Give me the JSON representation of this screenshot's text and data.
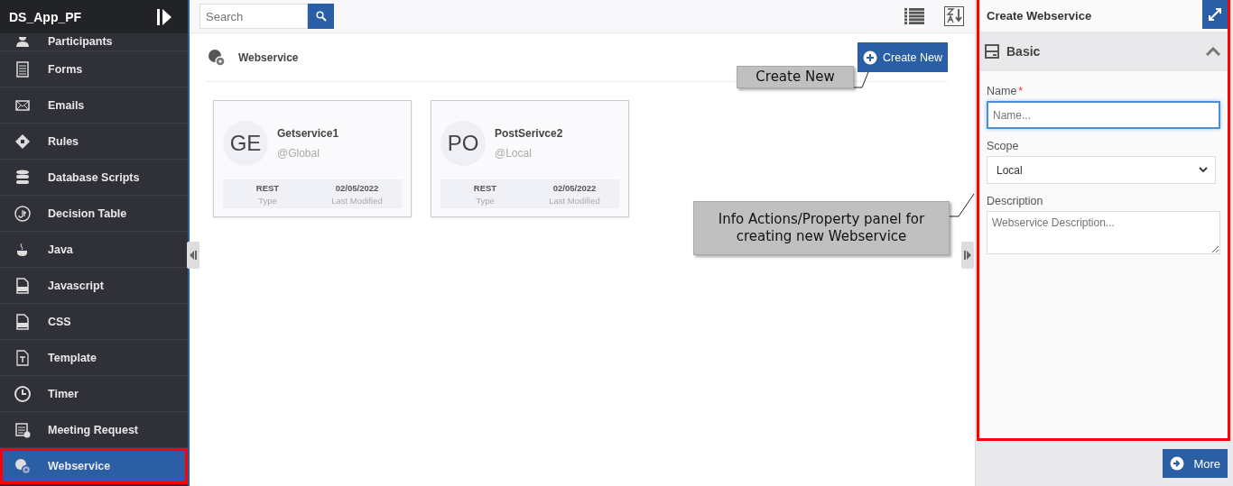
{
  "app": {
    "title": "DS_App_PF"
  },
  "sidebar": {
    "items": [
      {
        "label": "Participants",
        "selected": false,
        "highlighted": false
      },
      {
        "label": "Forms",
        "selected": false,
        "highlighted": false
      },
      {
        "label": "Emails",
        "selected": false,
        "highlighted": false
      },
      {
        "label": "Rules",
        "selected": false,
        "highlighted": false
      },
      {
        "label": "Database Scripts",
        "selected": false,
        "highlighted": false
      },
      {
        "label": "Decision Table",
        "selected": false,
        "highlighted": false
      },
      {
        "label": "Java",
        "selected": false,
        "highlighted": false
      },
      {
        "label": "Javascript",
        "selected": false,
        "highlighted": false
      },
      {
        "label": "CSS",
        "selected": false,
        "highlighted": false
      },
      {
        "label": "Template",
        "selected": false,
        "highlighted": false
      },
      {
        "label": "Timer",
        "selected": false,
        "highlighted": false
      },
      {
        "label": "Meeting Request",
        "selected": false,
        "highlighted": false
      },
      {
        "label": "Webservice",
        "selected": true,
        "highlighted": true
      }
    ]
  },
  "toolbar": {
    "search": {
      "placeholder": "Search"
    }
  },
  "section": {
    "title": "Webservice",
    "create_button": "Create New"
  },
  "cards": [
    {
      "initials": "GE",
      "name": "Getservice1",
      "scope": "@Global",
      "type": "REST",
      "type_label": "Type",
      "date": "02/05/2022",
      "date_label": "Last Modified"
    },
    {
      "initials": "PO",
      "name": "PostSerivce2",
      "scope": "@Local",
      "type": "REST",
      "type_label": "Type",
      "date": "02/05/2022",
      "date_label": "Last Modified"
    }
  ],
  "callouts": [
    {
      "text": "Create New"
    },
    {
      "text": "Info Actions/Property panel for creating new Webservice"
    }
  ],
  "panel": {
    "title": "Create Webservice",
    "highlighted": true,
    "section": {
      "title": "Basic",
      "expanded": true
    },
    "fields": [
      {
        "kind": "input",
        "label": "Name",
        "required_mark": "*",
        "placeholder": "Name..."
      },
      {
        "kind": "select",
        "label": "Scope",
        "value": "Local"
      },
      {
        "kind": "textarea",
        "label": "Description",
        "placeholder": "Webservice Description..."
      }
    ],
    "more_button": "More"
  }
}
